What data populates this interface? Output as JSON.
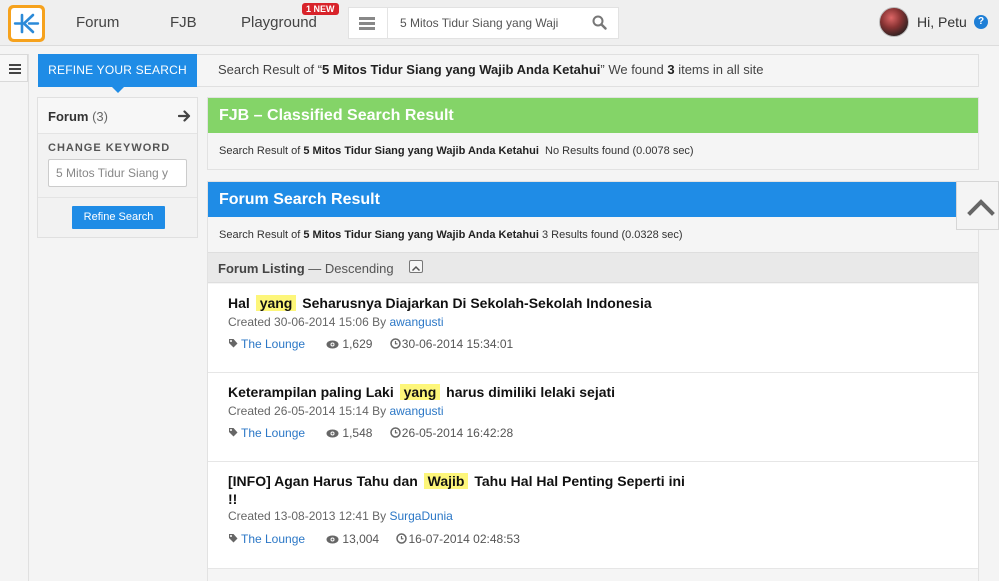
{
  "colors": {
    "brand_orange": "#f6a21d",
    "primary_blue": "#1f8ce6",
    "fjb_green": "#84d468",
    "highlight_yellow": "#fdf67a",
    "link_blue": "#2b77c6"
  },
  "header": {
    "nav": {
      "forum": "Forum",
      "fjb": "FJB",
      "playground": "Playground",
      "new_badge": "1 NEW"
    },
    "search_value": "5 Mitos Tidur Siang yang Waji",
    "greeting": "Hi, Petu",
    "help": "?"
  },
  "refine": {
    "tab_label": "REFINE YOUR SEARCH",
    "summary_prefix": "Search Result of “",
    "query": "5 Mitos Tidur Siang yang Wajib Anda Ketahui",
    "summary_mid": "” We found ",
    "count": "3",
    "summary_suffix": " items in all site"
  },
  "filter": {
    "forum_label": "Forum",
    "forum_count": "(3)",
    "change_keyword": "CHANGE KEYWORD",
    "keyword_value": "5 Mitos Tidur Siang y",
    "refine_button": "Refine Search"
  },
  "fjb": {
    "title": "FJB – Classified Search Result",
    "prefix": "Search Result of ",
    "query": "5 Mitos Tidur Siang yang Wajib Anda Ketahui",
    "result": "No Results found (0.0078 sec)"
  },
  "forum": {
    "title": "Forum Search Result",
    "prefix": "Search Result of ",
    "query": "5 Mitos Tidur Siang yang Wajib Anda Ketahui",
    "result": "3 Results found (0.0328 sec)",
    "listing_label": "Forum Listing",
    "listing_order": " — Descending",
    "items": [
      {
        "title_pre": "Hal ",
        "title_hl": "yang",
        "title_post": " Seharusnya Diajarkan Di Sekolah-Sekolah Indonesia",
        "created": "Created 30-06-2014 15:06 By ",
        "author": "awangusti",
        "category": "The Lounge",
        "views": "1,629",
        "last": "30-06-2014 15:34:01"
      },
      {
        "title_pre": "Keterampilan paling Laki ",
        "title_hl": "yang",
        "title_post": " harus dimiliki lelaki sejati",
        "created": "Created 26-05-2014 15:14 By ",
        "author": "awangusti",
        "category": "The Lounge",
        "views": "1,548",
        "last": "26-05-2014 16:42:28"
      },
      {
        "title_pre": "[INFO] Agan Harus Tahu dan ",
        "title_hl": "Wajib",
        "title_post": " Tahu Hal Hal Penting Seperti ini !!",
        "created": "Created 13-08-2013 12:41 By ",
        "author": "SurgaDunia",
        "category": "The Lounge",
        "views": "13,004",
        "last": "16-07-2014 02:48:53"
      }
    ]
  }
}
